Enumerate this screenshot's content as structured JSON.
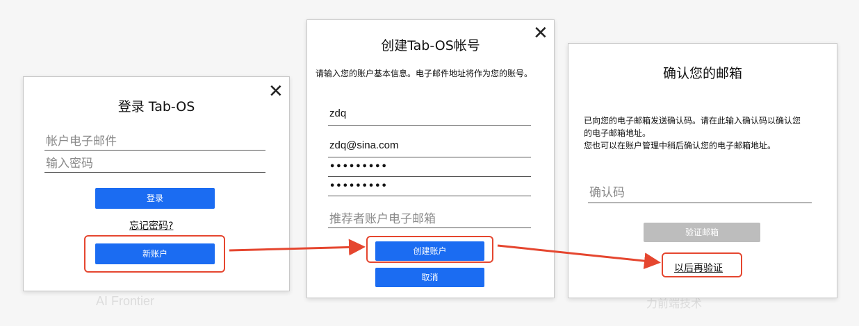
{
  "background": {
    "watermark": "AI Frontier",
    "watermark2": "力前端技术"
  },
  "login": {
    "title": "登录 Tab-OS",
    "close_icon": "close-icon",
    "email_placeholder": "帐户电子邮件",
    "password_placeholder": "输入密码",
    "login_label": "登录",
    "forgot_label": "忘记密码?",
    "new_account_label": "新账户"
  },
  "create": {
    "title": "创建Tab-OS帐号",
    "close_icon": "close-icon",
    "description": "请输入您的账户基本信息。电子邮件地址将作为您的账号。",
    "username_value": "zdq",
    "email_value": "zdq@sina.com",
    "password_value": "•••••••••",
    "confirm_password_value": "•••••••••",
    "referrer_placeholder": "推荐者账户电子邮箱",
    "create_label": "创建账户",
    "cancel_label": "取消"
  },
  "verify": {
    "title": "确认您的邮箱",
    "line1": "已向您的电子邮箱发送确认码。请在此输入确认码以确认您的电子邮箱地址。",
    "line2": "您也可以在账户管理中稍后确认您的电子邮箱地址。",
    "code_placeholder": "确认码",
    "verify_label": "验证邮箱",
    "later_label": "以后再验证"
  },
  "colors": {
    "primary_button": "#1b6cf2",
    "disabled_button": "#bdbdbd",
    "highlight": "#e5462f"
  }
}
